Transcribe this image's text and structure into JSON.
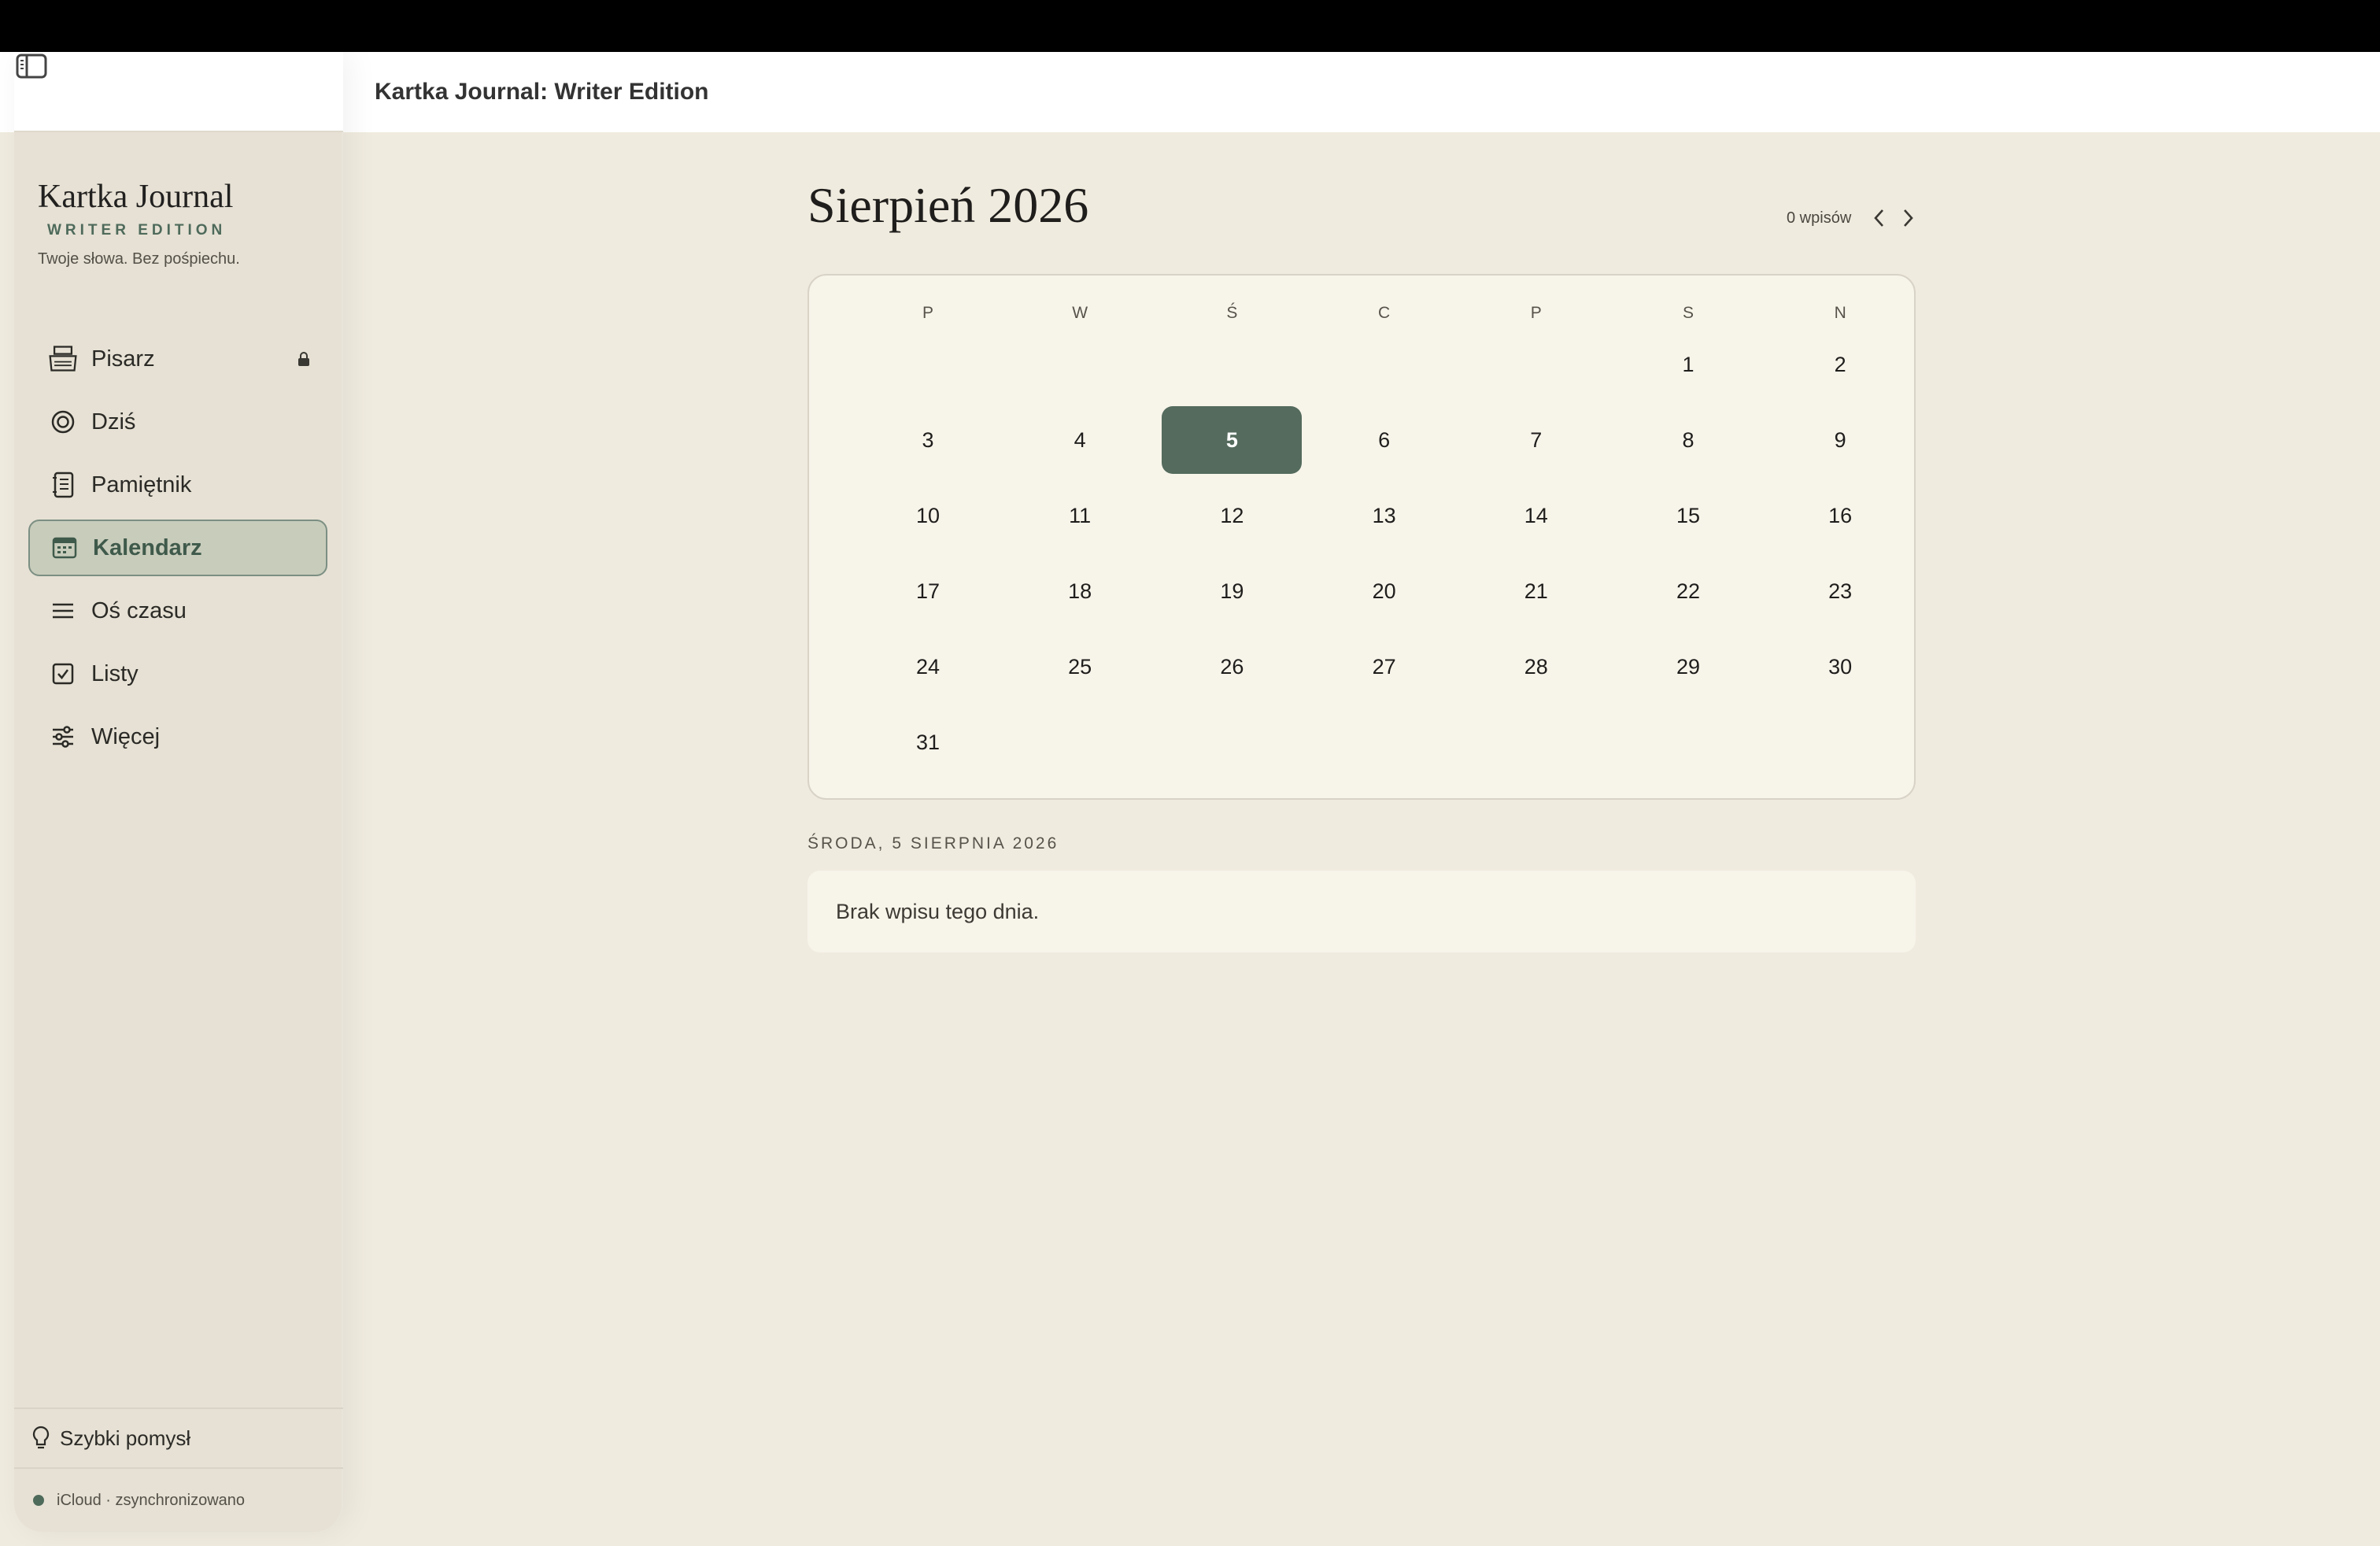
{
  "window": {
    "title": "Kartka Journal: Writer Edition"
  },
  "brand": {
    "title": "Kartka Journal",
    "edition": "WRITER EDITION",
    "tagline": "Twoje słowa. Bez pośpiechu."
  },
  "sidebar": {
    "items": [
      {
        "label": "Pisarz",
        "icon": "typewriter-icon",
        "locked": true
      },
      {
        "label": "Dziś",
        "icon": "target-icon"
      },
      {
        "label": "Pamiętnik",
        "icon": "notebook-icon"
      },
      {
        "label": "Kalendarz",
        "icon": "calendar-icon",
        "active": true
      },
      {
        "label": "Oś czasu",
        "icon": "lines-icon"
      },
      {
        "label": "Listy",
        "icon": "checkbox-icon"
      },
      {
        "label": "Więcej",
        "icon": "sliders-icon"
      }
    ],
    "quick_idea": "Szybki pomysł",
    "sync_status": "iCloud · zsynchronizowano"
  },
  "calendar": {
    "month_title": "Sierpień 2026",
    "entry_count": "0 wpisów",
    "weekdays": [
      "P",
      "W",
      "Ś",
      "C",
      "P",
      "S",
      "N"
    ],
    "first_weekday_index": 5,
    "days_in_month": 31,
    "selected_day": 5
  },
  "day_detail": {
    "date_heading": "ŚRODA, 5 SIERPNIA 2026",
    "empty_message": "Brak wpisu tego dnia."
  },
  "colors": {
    "accent": "#546b5d",
    "background": "#f0ebdf",
    "sidebar": "#e6e1d4",
    "card": "#f7f4ea"
  }
}
